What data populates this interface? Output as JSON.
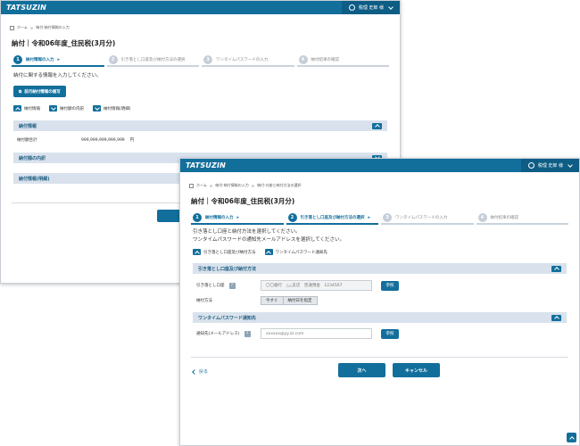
{
  "app": {
    "logo": "TATSUZIN",
    "user_name": "税理 史郎 様"
  },
  "window1": {
    "breadcrumb": [
      "ホーム",
      "納付-納付情報の入力"
    ],
    "page_title": "納付｜令和06年度_住民税(3月分)",
    "steps": [
      {
        "num": "1",
        "label": "納付情報の入力"
      },
      {
        "num": "2",
        "label": "引き落とし口座及び納付方法の選択"
      },
      {
        "num": "3",
        "label": "ワンタイムパスワードの入力"
      },
      {
        "num": "4",
        "label": "納付結果の確認"
      }
    ],
    "lead": "納付に関する情報を入力してください。",
    "recent_button": "前月納付情報の複写",
    "toggles": [
      "納付情報",
      "納付額の内訳",
      "納付情報(明細)"
    ],
    "sections": {
      "info": "納付情報",
      "breakdown": "納付額の内訳",
      "detail": "納付情報(明細)"
    },
    "amount_label": "納付額合計",
    "amount_value": "999,999,999,999,999",
    "amount_unit": "円"
  },
  "window2": {
    "breadcrumb": [
      "ホーム",
      "納付-納付情報の入力",
      "納付-口座と納付方法の選択"
    ],
    "page_title": "納付｜令和06年度_住民税(3月分)",
    "steps": [
      {
        "num": "1",
        "label": "納付情報の入力"
      },
      {
        "num": "2",
        "label": "引き落とし口座及び納付方法の選択"
      },
      {
        "num": "3",
        "label": "ワンタイムパスワードの入力"
      },
      {
        "num": "4",
        "label": "納付結果の確認"
      }
    ],
    "lead_line1": "引き落とし口座と納付方法を選択してください。",
    "lead_line2": "ワンタイムパスワードの通知先メールアドレスを選択してください。",
    "toggles": [
      "引き落とし口座及び納付方法",
      "ワンタイムパスワード通知先"
    ],
    "section_account": "引き落とし口座及び納付方法",
    "account_label": "引き落とし口座",
    "account_value": "〇〇銀行　△△支店　普通預金　1234567",
    "ref_button": "参照",
    "method_label": "納付方法",
    "method_options": [
      "今すぐ",
      "納付日を指定"
    ],
    "section_otp": "ワンタイムパスワード通知先",
    "email_label": "通知先(メールアドレス)",
    "email_placeholder": "xxxxxx@yy.zz.com",
    "back_link": "戻る",
    "next_button": "次へ",
    "cancel_button": "キャンセル"
  }
}
